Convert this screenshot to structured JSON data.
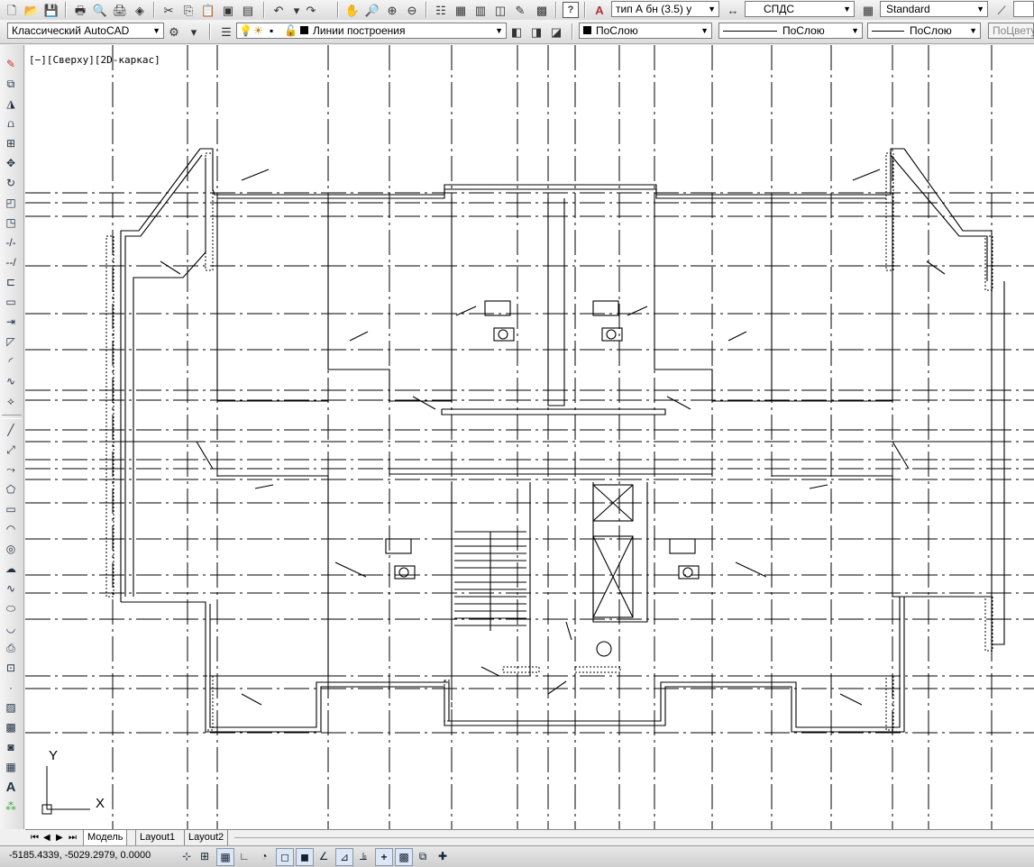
{
  "toolbar_standard": {
    "text_style_select": "тип А бн (3.5) у",
    "dim_style_select": "СПДС",
    "table_style_select": "Standard"
  },
  "toolbar_layers": {
    "workspace_select": "Классический AutoCAD",
    "layer_select": "Линии построения",
    "color_select": "ПоСлою",
    "linetype_select": "ПоСлою",
    "lineweight_select": "ПоСлою",
    "plotstyle_select": "ПоЦвету"
  },
  "viewport": {
    "label": "[−][Сверху][2D-каркас]",
    "ucs_x": "X",
    "ucs_y": "Y"
  },
  "tabs": [
    "Модель",
    "Layout1",
    "Layout2"
  ],
  "status": {
    "coordinates": "-5185.4339, -5029.2979, 0.0000"
  },
  "icons": {
    "top_toolbar": [
      "new-icon",
      "open-icon",
      "save-icon",
      "print-icon",
      "preview-icon",
      "publish-icon",
      "3dprint-icon",
      "cut-icon",
      "copy-icon",
      "paste-icon",
      "match-icon",
      "block-icon",
      "undo-icon",
      "redo-icon",
      "pan-icon",
      "zoom-realtime-icon",
      "zoom-window-icon",
      "zoom-previous-icon",
      "properties-icon",
      "design-center-icon",
      "tool-palettes-icon",
      "sheet-set-icon",
      "markup-icon",
      "calculator-icon",
      "help-icon",
      "text-style-icon",
      "dim-style-icon",
      "table-style-icon",
      "multileader-style-icon"
    ],
    "left_toolbar": [
      "erase-icon",
      "copy-obj-icon",
      "mirror-icon",
      "offset-icon",
      "array-icon",
      "move-icon",
      "rotate-icon",
      "scale-icon",
      "stretch-icon",
      "trim-icon",
      "extend-icon",
      "break-icon",
      "join-icon",
      "chamfer-icon",
      "fillet-icon",
      "blend-icon",
      "explode-icon",
      "line-icon",
      "xline-icon",
      "polyline-icon",
      "polygon-icon",
      "rectangle-icon",
      "arc-icon",
      "circle-icon",
      "revcloud-icon",
      "spline-icon",
      "ellipse-icon",
      "ellipse-arc-icon",
      "insert-block-icon",
      "make-block-icon",
      "point-icon",
      "hatch-icon",
      "gradient-icon",
      "region-icon",
      "table-icon",
      "mtext-icon",
      "add-selected-icon"
    ]
  }
}
